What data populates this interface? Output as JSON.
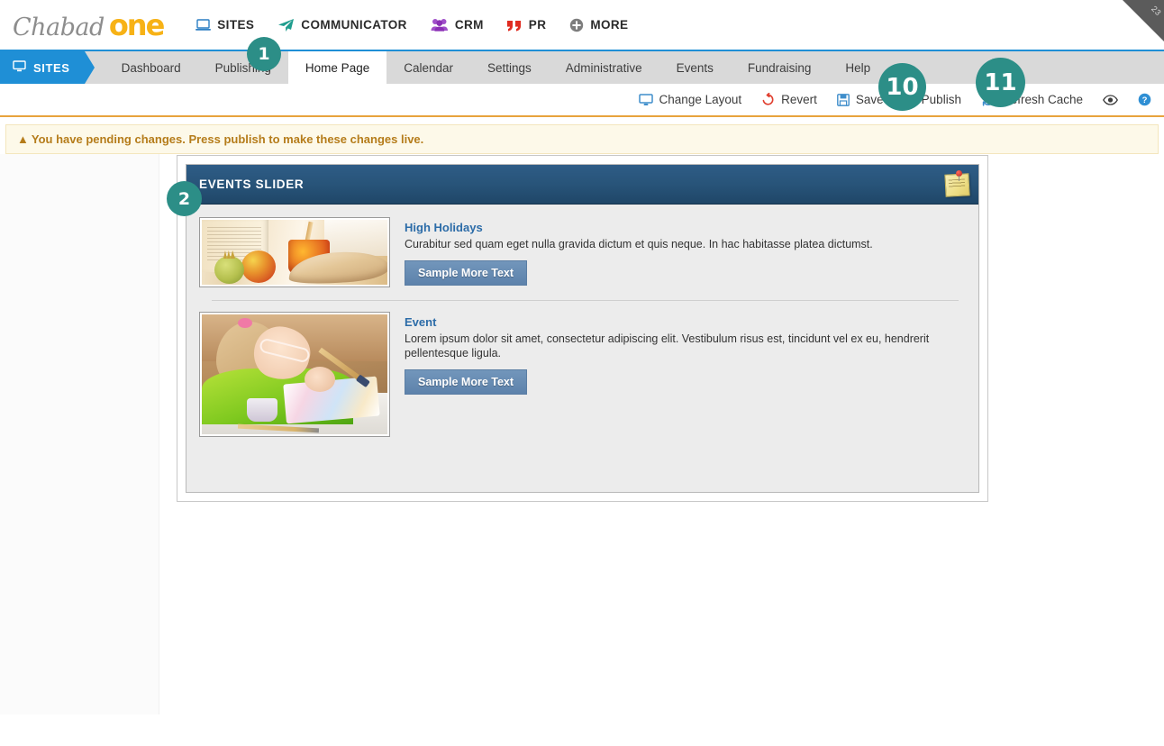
{
  "corner": {
    "label": "23"
  },
  "brand": {
    "first": "Chabad",
    "second": "one"
  },
  "mainnav": [
    {
      "icon": "laptop-icon",
      "label": "SITES"
    },
    {
      "icon": "paper-plane-icon",
      "label": "COMMUNICATOR"
    },
    {
      "icon": "people-group-icon",
      "label": "CRM"
    },
    {
      "icon": "quote-icon",
      "label": "PR"
    },
    {
      "icon": "plus-circle-icon",
      "label": "MORE"
    }
  ],
  "section_tab": {
    "icon": "monitor-icon",
    "label": "SITES"
  },
  "tabs": [
    {
      "label": "Dashboard",
      "active": false
    },
    {
      "label": "Publishing",
      "active": false
    },
    {
      "label": "Home Page",
      "active": true
    },
    {
      "label": "Calendar",
      "active": false
    },
    {
      "label": "Settings",
      "active": false
    },
    {
      "label": "Administrative",
      "active": false
    },
    {
      "label": "Events",
      "active": false
    },
    {
      "label": "Fundraising",
      "active": false
    },
    {
      "label": "Help",
      "active": false
    }
  ],
  "toolbar": [
    {
      "icon": "monitor-icon",
      "label": "Change Layout"
    },
    {
      "icon": "revert-arrow-icon",
      "label": "Revert"
    },
    {
      "icon": "floppy-disk-icon",
      "label": "Save"
    },
    {
      "icon": "document-publish-icon",
      "label": "Publish"
    },
    {
      "icon": "refresh-icon",
      "label": "Refresh Cache"
    },
    {
      "icon": "eye-icon",
      "label": "Preview"
    },
    {
      "icon": "help-circle-icon",
      "label": ""
    }
  ],
  "alert": {
    "icon": "warning-triangle-icon",
    "message": "You have pending changes. Press publish to make these changes live."
  },
  "module": {
    "title": "EVENTS SLIDER",
    "note_icon": "sticky-note-icon",
    "events": [
      {
        "image_alt": "high-holidays-apples-honey-shofar",
        "title": "High Holidays",
        "description": "Curabitur sed quam eget nulla gravida dictum et quis neque. In hac habitasse platea dictumst.",
        "button": "Sample More Text"
      },
      {
        "image_alt": "child-painting",
        "title": "Event",
        "description": "Lorem ipsum dolor sit amet, consectetur adipiscing elit. Vestibulum risus est, tincidunt vel ex eu, hendrerit pellentesque ligula.",
        "button": "Sample More Text"
      }
    ]
  },
  "badges": [
    {
      "id": "badge-1",
      "label": "1"
    },
    {
      "id": "badge-2",
      "label": "2"
    },
    {
      "id": "badge-10",
      "label": "10"
    },
    {
      "id": "badge-11",
      "label": "11"
    }
  ],
  "colors": {
    "brand_blue": "#1f8fd6",
    "brand_orange": "#f7b216",
    "badge_teal": "#2c8e87",
    "module_header": "#285479",
    "alert_text": "#b57c1a",
    "alert_bg": "#fdf9e9"
  }
}
